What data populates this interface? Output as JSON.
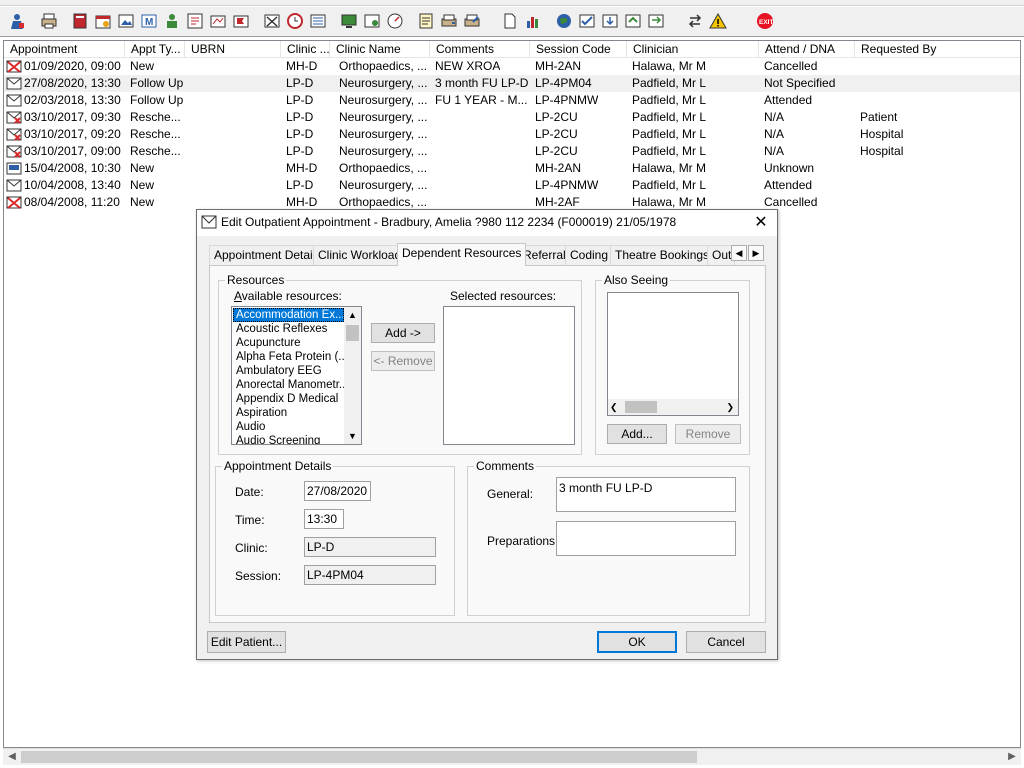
{
  "toolbar": {
    "buttons": [
      "patient-icon",
      "printer-icon",
      "book-icon",
      "calendar-icon",
      "image-icon",
      "mail-icon",
      "person-icon",
      "form-icon",
      "chart-icon",
      "flag-icon",
      "cancel-icon",
      "clock-icon",
      "list-icon",
      "monitor-icon",
      "letter-icon",
      "gauge-icon",
      "notes-icon",
      "print-letter-icon",
      "edit-letter-icon",
      "document-icon",
      "bar-chart-icon",
      "globe-icon",
      "check-list-icon",
      "download-icon",
      "refresh-icon",
      "swap-icon",
      "warning-icon",
      "exit-icon"
    ],
    "exit_label": "EXIT"
  },
  "list": {
    "columns": [
      "Appointment",
      "Appt Ty...",
      "UBRN",
      "Clinic ...",
      "Clinic Name",
      "Comments",
      "Session Code",
      "Clinician",
      "Attend / DNA",
      "Requested By"
    ],
    "rows": [
      {
        "icon": "cancelled",
        "appointment": "01/09/2020, 09:00",
        "type": "New",
        "ubrn": "",
        "clinic": "MH-D",
        "clinic_name": "Orthopaedics, ...",
        "comments": "NEW XROA",
        "session": "MH-2AN",
        "clinician": "Halawa, Mr M",
        "attend": "Cancelled",
        "requested": ""
      },
      {
        "icon": "envelope",
        "appointment": "27/08/2020, 13:30",
        "type": "Follow Up",
        "ubrn": "",
        "clinic": "LP-D",
        "clinic_name": "Neurosurgery, ...",
        "comments": "3 month FU LP-D",
        "session": "LP-4PM04",
        "clinician": "Padfield, Mr L",
        "attend": "Not Specified",
        "requested": ""
      },
      {
        "icon": "envelope",
        "appointment": "02/03/2018, 13:30",
        "type": "Follow Up",
        "ubrn": "",
        "clinic": "LP-D",
        "clinic_name": "Neurosurgery, ...",
        "comments": "FU 1 YEAR - M...",
        "session": "LP-4PNMW",
        "clinician": "Padfield, Mr L",
        "attend": "Attended",
        "requested": ""
      },
      {
        "icon": "rescheduled",
        "appointment": "03/10/2017, 09:30",
        "type": "Resche...",
        "ubrn": "",
        "clinic": "LP-D",
        "clinic_name": "Neurosurgery, ...",
        "comments": "",
        "session": "LP-2CU",
        "clinician": "Padfield, Mr L",
        "attend": "N/A",
        "requested": "Patient"
      },
      {
        "icon": "rescheduled",
        "appointment": "03/10/2017, 09:20",
        "type": "Resche...",
        "ubrn": "",
        "clinic": "LP-D",
        "clinic_name": "Neurosurgery, ...",
        "comments": "",
        "session": "LP-2CU",
        "clinician": "Padfield, Mr L",
        "attend": "N/A",
        "requested": "Hospital"
      },
      {
        "icon": "rescheduled",
        "appointment": "03/10/2017, 09:00",
        "type": "Resche...",
        "ubrn": "",
        "clinic": "LP-D",
        "clinic_name": "Neurosurgery, ...",
        "comments": "",
        "session": "LP-2CU",
        "clinician": "Padfield, Mr L",
        "attend": "N/A",
        "requested": "Hospital"
      },
      {
        "icon": "unknown",
        "appointment": "15/04/2008, 10:30",
        "type": "New",
        "ubrn": "",
        "clinic": "MH-D",
        "clinic_name": "Orthopaedics, ...",
        "comments": "",
        "session": "MH-2AN",
        "clinician": "Halawa, Mr M",
        "attend": "Unknown",
        "requested": ""
      },
      {
        "icon": "envelope",
        "appointment": "10/04/2008, 13:40",
        "type": "New",
        "ubrn": "",
        "clinic": "LP-D",
        "clinic_name": "Neurosurgery, ...",
        "comments": "",
        "session": "LP-4PNMW",
        "clinician": "Padfield, Mr L",
        "attend": "Attended",
        "requested": ""
      },
      {
        "icon": "cancelled",
        "appointment": "08/04/2008, 11:20",
        "type": "New",
        "ubrn": "",
        "clinic": "MH-D",
        "clinic_name": "Orthopaedics, ...",
        "comments": "",
        "session": "MH-2AF",
        "clinician": "Halawa, Mr M",
        "attend": "Cancelled",
        "requested": ""
      }
    ]
  },
  "dialog": {
    "title": "Edit Outpatient Appointment - Bradbury, Amelia ?980 112 2234 (F000019) 21/05/1978",
    "tabs": [
      "Appointment Details",
      "Clinic Workload",
      "Dependent Resources",
      "Referral",
      "Coding",
      "Theatre Bookings",
      "Out"
    ],
    "active_tab": "Dependent Resources",
    "resources_group": "Resources",
    "available_label": "Available resources:",
    "selected_label": "Selected resources:",
    "available_items": [
      "Accommodation Ex...",
      "Acoustic Reflexes",
      "Acupuncture",
      "Alpha Feta Protein (...",
      "Ambulatory EEG",
      "Anorectal Manometr...",
      "Appendix D Medical",
      "Aspiration",
      "Audio",
      "Audio Screening"
    ],
    "add_button": "Add ->",
    "remove_button": "<- Remove",
    "also_seeing_group": "Also Seeing",
    "also_add_button": "Add...",
    "also_remove_button": "Remove",
    "appt_details_group": "Appointment Details",
    "date_label": "Date:",
    "date_value": "27/08/2020",
    "time_label": "Time:",
    "time_value": "13:30",
    "clinic_label": "Clinic:",
    "clinic_value": "LP-D",
    "session_label": "Session:",
    "session_value": "LP-4PM04",
    "comments_group": "Comments",
    "general_label": "General:",
    "general_value": "3 month FU LP-D",
    "preparations_label": "Preparations:",
    "preparations_value": "",
    "edit_patient_button": "Edit Patient...",
    "ok_button": "OK",
    "cancel_button": "Cancel"
  },
  "colors": {
    "selection": "#0078d7",
    "default_button_border": "#0078d7",
    "exit_red": "#e81123"
  }
}
